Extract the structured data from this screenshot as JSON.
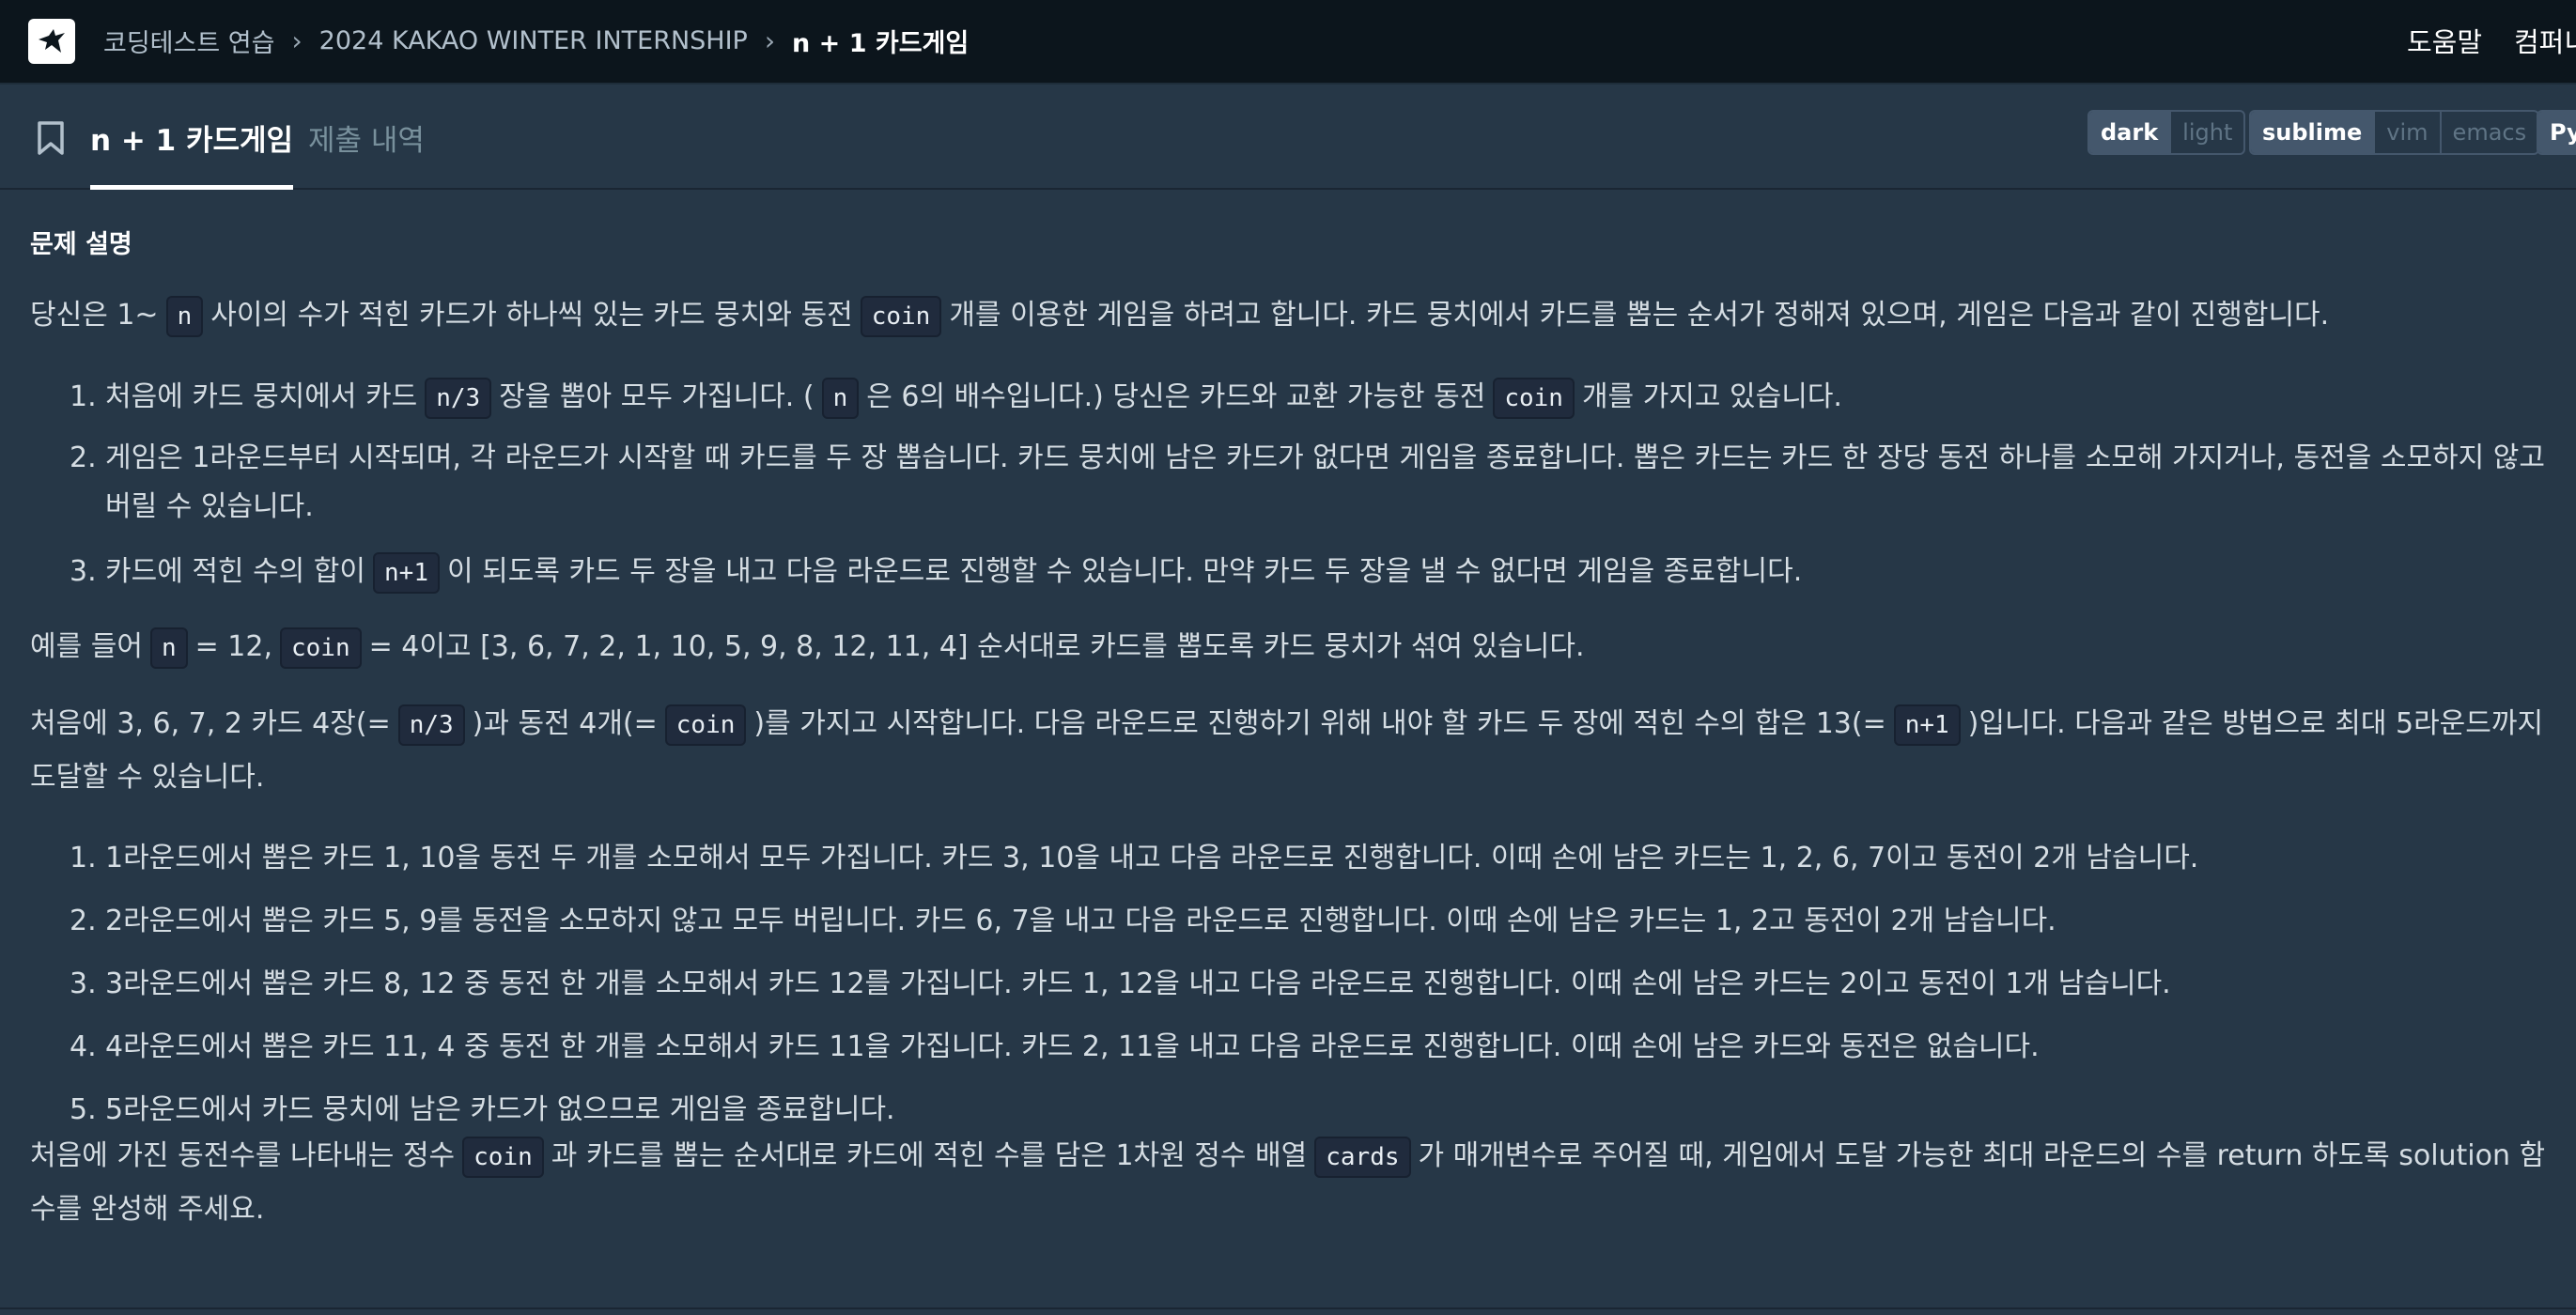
{
  "breadcrumb": {
    "items": [
      "코딩테스트 연습",
      "2024 KAKAO WINTER INTERNSHIP"
    ],
    "current": "n + 1 카드게임"
  },
  "topnav": {
    "help": "도움말",
    "company": "컴퍼니"
  },
  "tabs": {
    "problem": "n + 1 카드게임",
    "submissions": "제출 내역"
  },
  "toolbar": {
    "theme": {
      "dark": "dark",
      "light": "light",
      "selected": "dark"
    },
    "keymap": {
      "sublime": "sublime",
      "vim": "vim",
      "emacs": "emacs",
      "selected": "sublime"
    },
    "language": "Py"
  },
  "problem": {
    "section_title": "문제 설명",
    "intro": {
      "t1": "당신은 1~",
      "c1": "n",
      "t2": "사이의 수가 적힌 카드가 하나씩 있는 카드 뭉치와 동전",
      "c2": "coin",
      "t3": "개를 이용한 게임을 하려고 합니다. 카드 뭉치에서 카드를 뽑는 순서가 정해져 있으며, 게임은 다음과 같이 진행합니다."
    },
    "rules": [
      {
        "num": "1.",
        "t1": "처음에 카드 뭉치에서 카드",
        "c1": "n/3",
        "t2": "장을 뽑아 모두 가집니다. (",
        "c2": "n",
        "t3": "은 6의 배수입니다.) 당신은 카드와 교환 가능한 동전",
        "c3": "coin",
        "t4": "개를 가지고 있습니다."
      },
      {
        "num": "2.",
        "text": "게임은 1라운드부터 시작되며, 각 라운드가 시작할 때 카드를 두 장 뽑습니다. 카드 뭉치에 남은 카드가 없다면 게임을 종료합니다. 뽑은 카드는 카드 한 장당 동전 하나를 소모해 가지거나, 동전을 소모하지 않고 버릴 수 있습니다."
      },
      {
        "num": "3.",
        "t1": "카드에 적힌 수의 합이",
        "c1": "n+1",
        "t2": "이 되도록 카드 두 장을 내고 다음 라운드로 진행할 수 있습니다. 만약 카드 두 장을 낼 수 없다면 게임을 종료합니다."
      }
    ],
    "example": {
      "t1": "예를 들어",
      "c1": "n",
      "t2": "= 12,",
      "c2": "coin",
      "t3": "= 4이고 [3, 6, 7, 2, 1, 10, 5, 9, 8, 12, 11, 4] 순서대로 카드를 뽑도록 카드 뭉치가 섞여 있습니다."
    },
    "start": {
      "t1": "처음에 3, 6, 7, 2 카드 4장(=",
      "c1": "n/3",
      "t2": ")과 동전 4개(=",
      "c2": "coin",
      "t3": ")를 가지고 시작합니다. 다음 라운드로 진행하기 위해 내야 할 카드 두 장에 적힌 수의 합은 13(=",
      "c3": "n+1",
      "t4": ")입니다. 다음과 같은 방법으로 최대 5라운드까지 도달할 수 있습니다."
    },
    "rounds": [
      {
        "num": "1.",
        "text": "1라운드에서 뽑은 카드 1, 10을 동전 두 개를 소모해서 모두 가집니다. 카드 3, 10을 내고 다음 라운드로 진행합니다. 이때 손에 남은 카드는 1, 2, 6, 7이고 동전이 2개 남습니다."
      },
      {
        "num": "2.",
        "text": "2라운드에서 뽑은 카드 5, 9를 동전을 소모하지 않고 모두 버립니다. 카드 6, 7을 내고 다음 라운드로 진행합니다. 이때 손에 남은 카드는 1, 2고 동전이 2개 남습니다."
      },
      {
        "num": "3.",
        "text": "3라운드에서 뽑은 카드 8, 12 중 동전 한 개를 소모해서 카드 12를 가집니다. 카드 1, 12을 내고 다음 라운드로 진행합니다. 이때 손에 남은 카드는 2이고 동전이 1개 남습니다."
      },
      {
        "num": "4.",
        "text": "4라운드에서 뽑은 카드 11, 4 중 동전 한 개를 소모해서 카드 11을 가집니다. 카드 2, 11을 내고 다음 라운드로 진행합니다. 이때 손에 남은 카드와 동전은 없습니다."
      },
      {
        "num": "5.",
        "text": "5라운드에서 카드 뭉치에 남은 카드가 없으므로 게임을 종료합니다."
      }
    ],
    "task": {
      "t1": "처음에 가진 동전수를 나타내는 정수",
      "c1": "coin",
      "t2": "과 카드를 뽑는 순서대로 카드에 적힌 수를 담은 1차원 정수 배열",
      "c2": "cards",
      "t3": "가 매개변수로 주어질 때, 게임에서 도달 가능한 최대 라운드의 수를 return 하도록 solution 함수를 완성해 주세요."
    }
  }
}
